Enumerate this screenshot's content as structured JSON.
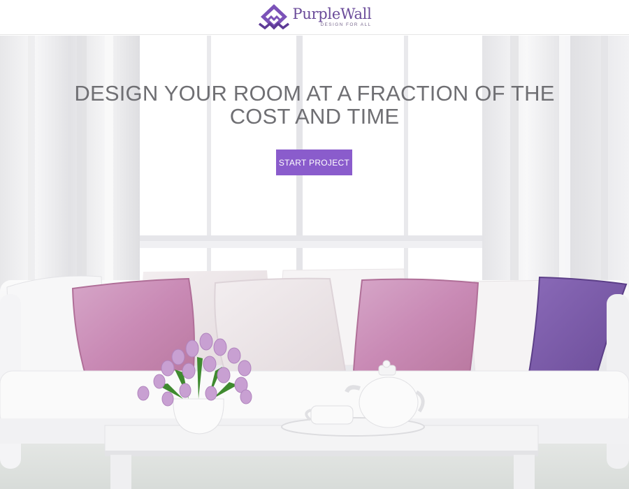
{
  "header": {
    "logo_name": "PurpleWall",
    "logo_tagline": "DESIGN FOR ALL",
    "logo_icon": "purplewall-logo-icon"
  },
  "hero": {
    "headline_line1": "DESIGN YOUR ROOM AT A FRACTION OF THE",
    "headline_line2": "COST AND TIME",
    "cta_label": "START PROJECT",
    "background_image": "living-room-sofa-photo"
  },
  "colors": {
    "brand_purple": "#8a5ccc",
    "logo_purple": "#6b4c9a",
    "headline_gray": "#6f6f73"
  }
}
